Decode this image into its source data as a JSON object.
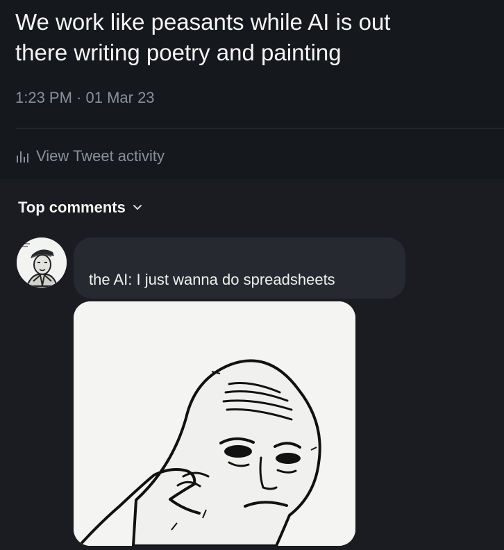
{
  "tweet": {
    "text_line1": "We work like peasants while AI is out",
    "text_line2": "there writing poetry and painting",
    "timestamp": "1:23 PM · 01 Mar 23",
    "activity_label": "View Tweet activity"
  },
  "comments": {
    "header_label": "Top comments",
    "items": [
      {
        "text": "the AI: I just wanna do spreadsheets",
        "image": "tired-wojak-meme"
      }
    ]
  },
  "colors": {
    "background": "#181a1f",
    "text": "#f5f5f5",
    "muted": "#8b9098",
    "bubble": "#26292f"
  }
}
